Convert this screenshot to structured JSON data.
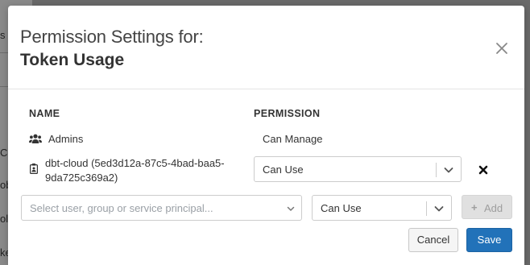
{
  "background": {
    "fragments": [
      "s",
      "Co",
      "ob",
      "ol:",
      "ke"
    ]
  },
  "modal": {
    "title_prefix": "Permission Settings for:",
    "title": "Token Usage",
    "close_icon": "close-icon"
  },
  "table": {
    "headers": {
      "name": "NAME",
      "permission": "PERMISSION"
    },
    "rows": [
      {
        "icon": "users-icon",
        "name": "Admins",
        "permission": "Can Manage",
        "editable": false
      },
      {
        "icon": "service-principal-icon",
        "name_line1": "dbt-cloud (5ed3d12a-87c5-4bad-baa5-",
        "name_line2": "9da725c369a2)",
        "permission": "Can Use",
        "editable": true
      }
    ]
  },
  "add_row": {
    "principal_placeholder": "Select user, group or service principal...",
    "permission_value": "Can Use",
    "add_label": "Add"
  },
  "footer": {
    "cancel_label": "Cancel",
    "save_label": "Save"
  },
  "colors": {
    "primary": "#2272b9",
    "overlay": "#6a6a6a"
  }
}
